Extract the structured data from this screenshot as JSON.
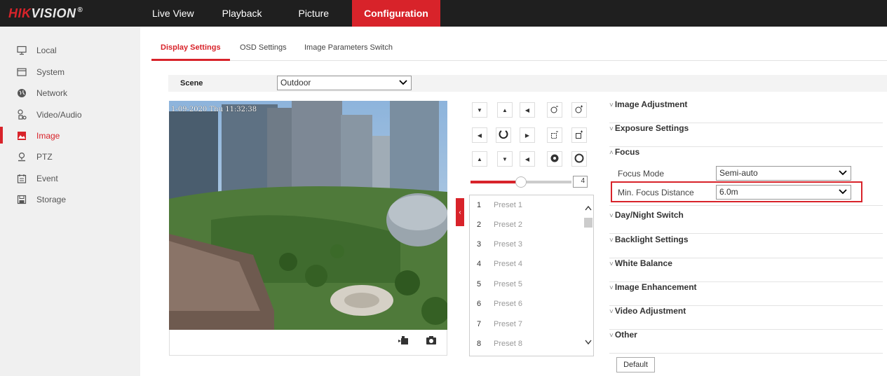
{
  "brand": {
    "logo_red": "HIK",
    "logo_rest": "VISION",
    "logo_mark": "®"
  },
  "nav": {
    "live_view": "Live View",
    "playback": "Playback",
    "picture": "Picture",
    "configuration": "Configuration"
  },
  "sidebar": {
    "items": [
      {
        "label": "Local",
        "icon": "monitor-icon"
      },
      {
        "label": "System",
        "icon": "system-icon"
      },
      {
        "label": "Network",
        "icon": "globe-icon"
      },
      {
        "label": "Video/Audio",
        "icon": "video-audio-icon"
      },
      {
        "label": "Image",
        "icon": "image-icon"
      },
      {
        "label": "PTZ",
        "icon": "ptz-icon"
      },
      {
        "label": "Event",
        "icon": "calendar-icon"
      },
      {
        "label": "Storage",
        "icon": "storage-icon"
      }
    ]
  },
  "tabs": {
    "display": "Display Settings",
    "osd": "OSD Settings",
    "switch": "Image Parameters Switch"
  },
  "scene": {
    "label": "Scene",
    "value": "Outdoor"
  },
  "video": {
    "osd_text": "1-09-2020 Thu 11:32:38"
  },
  "ptz": {
    "speed": "4",
    "speed_level": 0.5
  },
  "presets": [
    {
      "num": "1",
      "name": "Preset 1"
    },
    {
      "num": "2",
      "name": "Preset 2"
    },
    {
      "num": "3",
      "name": "Preset 3"
    },
    {
      "num": "4",
      "name": "Preset 4"
    },
    {
      "num": "5",
      "name": "Preset 5"
    },
    {
      "num": "6",
      "name": "Preset 6"
    },
    {
      "num": "7",
      "name": "Preset 7"
    },
    {
      "num": "8",
      "name": "Preset 8"
    }
  ],
  "sections": {
    "image_adjustment": "Image Adjustment",
    "exposure": "Exposure Settings",
    "focus": "Focus",
    "day_night": "Day/Night Switch",
    "backlight": "Backlight Settings",
    "white_balance": "White Balance",
    "enhancement": "Image Enhancement",
    "video_adjustment": "Video Adjustment",
    "other": "Other"
  },
  "focus": {
    "mode_label": "Focus Mode",
    "mode_value": "Semi-auto",
    "min_label": "Min. Focus Distance",
    "min_value": "6.0m"
  },
  "default_button": "Default",
  "colors": {
    "accent": "#d8232a",
    "topbar": "#1f1f1f",
    "sidebar": "#f0f0f0"
  }
}
